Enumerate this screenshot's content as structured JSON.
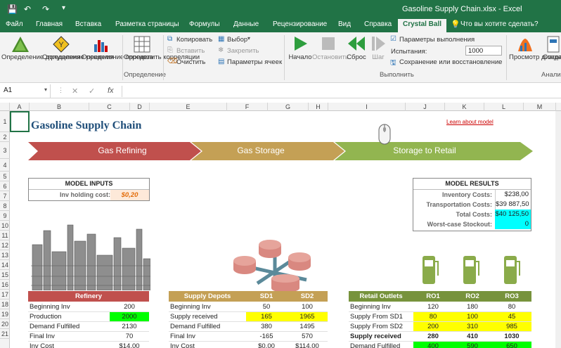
{
  "titlebar": {
    "doc_title": "Gasoline Supply Chain.xlsx  -  Excel"
  },
  "tabs": [
    {
      "label": "Файл"
    },
    {
      "label": "Главная"
    },
    {
      "label": "Вставка"
    },
    {
      "label": "Разметка страницы"
    },
    {
      "label": "Формулы"
    },
    {
      "label": "Данные"
    },
    {
      "label": "Рецензирование"
    },
    {
      "label": "Вид"
    },
    {
      "label": "Справка"
    },
    {
      "label": "Crystal Ball"
    }
  ],
  "tell_me": "Что вы хотите сделать?",
  "ribbon": {
    "define_assumption": "Определение допущения",
    "define_decision": "Определение решения",
    "define_forecast": "Определение прогноза",
    "define_correlations": "Определить корреляции",
    "group_define": "Определение",
    "copy": "Копировать",
    "paste": "Вставить",
    "clear": "Очистить",
    "select": "Выбор",
    "freeze": "Закрепить",
    "cell_prefs": "Параметры ячеек",
    "start": "Начало",
    "stop": "Остановить",
    "reset": "Сброс",
    "step": "Шаг",
    "run_prefs": "Параметры выполнения",
    "trials_label": "Испытания:",
    "trials_value": "1000",
    "save_restore": "Сохранение или восстановление",
    "group_run": "Выполнить",
    "view_charts": "Просмотр диаграммы",
    "create_report": "Созда отчет",
    "group_analyze": "Анализ"
  },
  "formula_bar": {
    "name_box": "A1",
    "fx": "fx"
  },
  "columns": [
    "A",
    "B",
    "C",
    "D",
    "E",
    "F",
    "G",
    "H",
    "I",
    "J",
    "K",
    "L",
    "M"
  ],
  "rows": [
    "1",
    "2",
    "3",
    "4",
    "5",
    "6",
    "7",
    "8",
    "9",
    "10",
    "11",
    "12",
    "13",
    "14",
    "15",
    "16",
    "17",
    "18",
    "19",
    "20",
    "21"
  ],
  "sheet": {
    "title": "Gasoline Supply Chain",
    "learn_link": "Learn about model",
    "stages": [
      "Gas Refining",
      "Gas Storage",
      "Storage to Retail"
    ],
    "model_inputs": {
      "header": "MODEL INPUTS",
      "label": "Inv holding cost:",
      "value": "$0,20"
    },
    "model_results": {
      "header": "MODEL RESULTS",
      "rows": [
        {
          "label": "Inventory Costs:",
          "value": "$238,00"
        },
        {
          "label": "Transportation Costs:",
          "value": "$39 887,50"
        },
        {
          "label": "Total Costs:",
          "value": "$40 125,50"
        },
        {
          "label": "Worst-case Stockout:",
          "value": "0"
        }
      ]
    },
    "refinery": {
      "header": "Refinery",
      "rows": [
        {
          "label": "Beginning Inv",
          "value": "200"
        },
        {
          "label": "Production",
          "value": "2000"
        },
        {
          "label": "Demand Fulfilled",
          "value": "2130"
        },
        {
          "label": "Final Inv",
          "value": "70"
        },
        {
          "label": "Inv Cost",
          "value": "$14,00"
        }
      ]
    },
    "depots": {
      "header": "Supply Depots",
      "cols": [
        "SD1",
        "SD2"
      ],
      "rows": [
        {
          "label": "Beginning Inv",
          "values": [
            "50",
            "100"
          ]
        },
        {
          "label": "Supply received",
          "values": [
            "165",
            "1965"
          ]
        },
        {
          "label": "Demand Fulfilled",
          "values": [
            "380",
            "1495"
          ]
        },
        {
          "label": "Final Inv",
          "values": [
            "-165",
            "570"
          ]
        },
        {
          "label": "Inv Cost",
          "values": [
            "$0,00",
            "$114,00"
          ]
        }
      ]
    },
    "retail": {
      "header": "Retail Outlets",
      "cols": [
        "RO1",
        "RO2",
        "RO3"
      ],
      "rows": [
        {
          "label": "Beginning Inv",
          "values": [
            "120",
            "180",
            "80"
          ]
        },
        {
          "label": "Supply From SD1",
          "values": [
            "80",
            "100",
            "45"
          ]
        },
        {
          "label": "Supply From SD2",
          "values": [
            "200",
            "310",
            "985"
          ]
        },
        {
          "label": "Supply received",
          "values": [
            "280",
            "410",
            "1030"
          ]
        },
        {
          "label": "Demand Fulfilled",
          "values": [
            "400",
            "590",
            "650"
          ]
        }
      ]
    }
  },
  "colors": {
    "excel_green": "#217346",
    "refining": "#c0504d",
    "storage": "#c4a055",
    "retail": "#92b550",
    "highlight_green": "#00ff00",
    "highlight_yellow": "#ffff00",
    "highlight_cyan": "#00ffff"
  }
}
